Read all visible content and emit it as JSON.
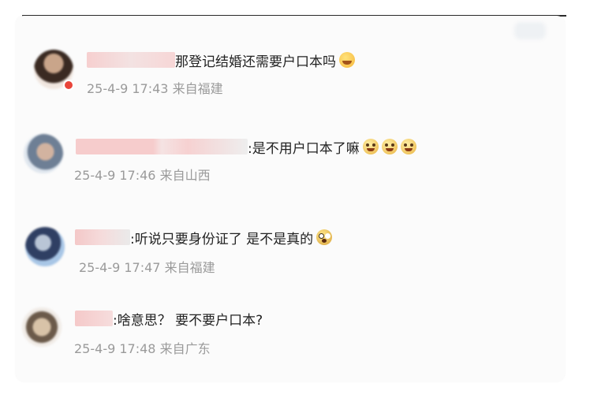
{
  "comments": [
    {
      "text": "那登记结婚还需要户口本吗",
      "emoji": "laugh-cry-emoji",
      "time": "25-4-9 17:43",
      "location": "来自福建"
    },
    {
      "text": ":是不用户口本了嘛",
      "emoji": "crying-emoji",
      "time": "25-4-9 17:46",
      "location": "来自山西"
    },
    {
      "text": ":听说只要身份证了 是不是真的",
      "emoji": "shocked-emoji",
      "time": "25-4-9 17:47",
      "location": "来自福建"
    },
    {
      "text": ":啥意思？ 要不要户口本?",
      "emoji": "",
      "time": "25-4-9 17:48",
      "location": "来自广东"
    }
  ]
}
